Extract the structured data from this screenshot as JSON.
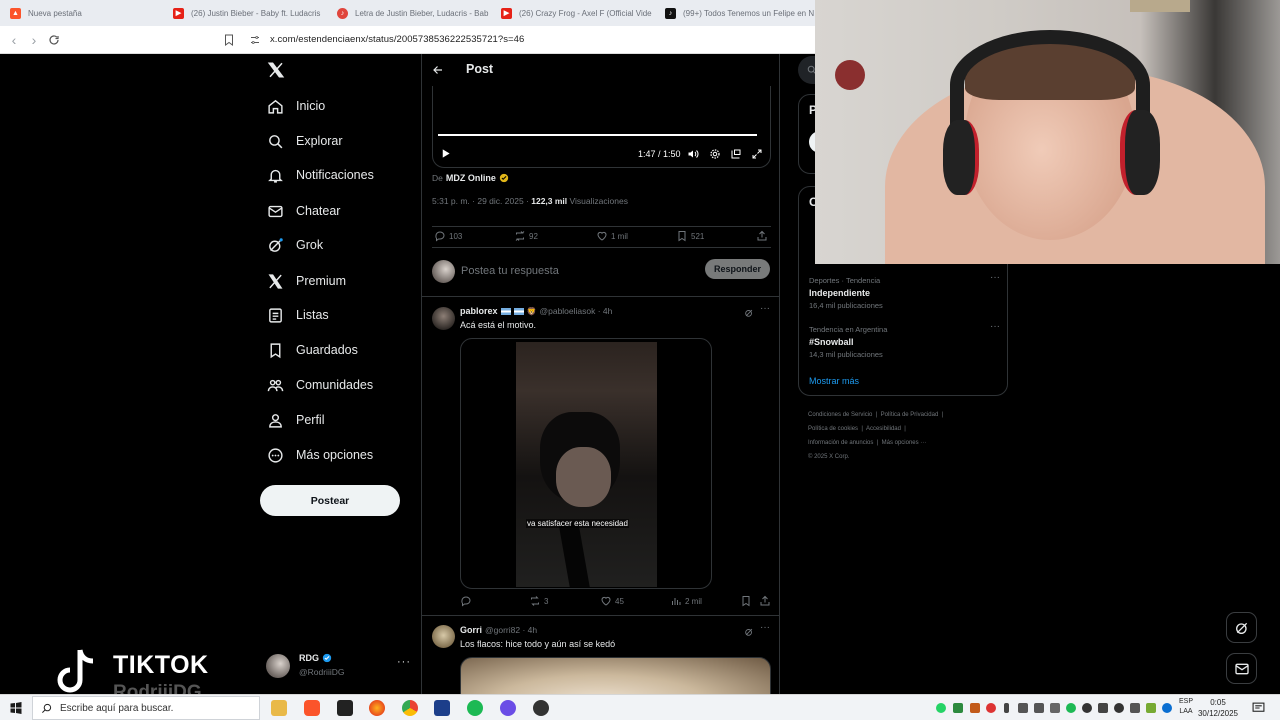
{
  "browser": {
    "tabs": [
      {
        "label": "Nueva pestaña",
        "icon": "brave-icon",
        "color": "#fb542b"
      },
      {
        "label": "(26) Justin Bieber - Baby ft. Ludacris",
        "icon": "youtube-icon",
        "color": "#e62117"
      },
      {
        "label": "Letra de Justin Bieber, Ludacris - Bab",
        "icon": "lyrics-site-icon",
        "color": "#e0453c"
      },
      {
        "label": "(26) Crazy Frog - Axel F (Official Vide",
        "icon": "youtube-icon",
        "color": "#e62117"
      },
      {
        "label": "(99+) Todos Tenemos un Felipe en N",
        "icon": "tiktok-icon",
        "color": "#111111"
      }
    ],
    "url": "x.com/estendenciaenx/status/2005738536222535721?s=46"
  },
  "nav": {
    "items": [
      {
        "label": "Inicio",
        "icon": "home-icon"
      },
      {
        "label": "Explorar",
        "icon": "search-icon"
      },
      {
        "label": "Notificaciones",
        "icon": "bell-icon"
      },
      {
        "label": "Chatear",
        "icon": "mail-icon"
      },
      {
        "label": "Grok",
        "icon": "grok-icon"
      },
      {
        "label": "Premium",
        "icon": "x-premium-icon"
      },
      {
        "label": "Listas",
        "icon": "list-icon"
      },
      {
        "label": "Guardados",
        "icon": "bookmark-icon"
      },
      {
        "label": "Comunidades",
        "icon": "communities-icon"
      },
      {
        "label": "Perfil",
        "icon": "person-icon"
      },
      {
        "label": "Más opciones",
        "icon": "more-circle-icon"
      }
    ],
    "post_button": "Postear",
    "profile": {
      "name": "RDG",
      "handle": "@RodriiiDG"
    }
  },
  "post": {
    "header_title": "Post",
    "video": {
      "time": "1:47 / 1:50",
      "progress": 0.973
    },
    "source_prefix": "De",
    "source_name": "MDZ Online",
    "timestamp": "5:31 p. m. · 29 dic. 2025 ·",
    "views_count": "122,3 mil",
    "views_label": "Visualizaciones",
    "stats": {
      "replies": "103",
      "reposts": "92",
      "likes": "1 mil",
      "bookmarks": "521"
    },
    "reply_placeholder": "Postea tu respuesta",
    "reply_button": "Responder"
  },
  "replies": [
    {
      "name": "pablorex",
      "handle": "@pabloeliasok · 4h",
      "text": "Acá está el motivo.",
      "caption": "va satisfacer esta necesidad",
      "stats": {
        "replies": "",
        "reposts": "3",
        "likes": "45",
        "views": "2 mil"
      }
    },
    {
      "name": "Gorri",
      "handle": "@gorri82 · 4h",
      "text": "Los flacos: hice todo y aún así se kedó"
    }
  ],
  "right": {
    "search_initial": "P",
    "trends_header_initial": "C",
    "trends": [
      {
        "category": "Deportes · Tendencia",
        "name": "Independiente",
        "count": "16,4 mil publicaciones"
      },
      {
        "category": "Tendencia en Argentina",
        "name": "#Snowball",
        "count": "14,3 mil publicaciones"
      }
    ],
    "show_more": "Mostrar más",
    "footer": [
      "Condiciones de Servicio",
      "Política de Privacidad",
      "Política de cookies",
      "Accesibilidad",
      "Información de anuncios",
      "Más opciones ···",
      "© 2025 X Corp."
    ]
  },
  "watermark": {
    "brand": "TIKTOK",
    "user": "RodriiiDG"
  },
  "taskbar": {
    "search_placeholder": "Escribe aquí para buscar.",
    "lang_top": "ESP",
    "lang_bottom": "LAA",
    "time": "0:05",
    "date": "30/12/2025"
  },
  "colors": {
    "accent": "#1d9bf0",
    "verified_gold": "#e2b719",
    "border": "#2f3336",
    "muted": "#71767b"
  }
}
